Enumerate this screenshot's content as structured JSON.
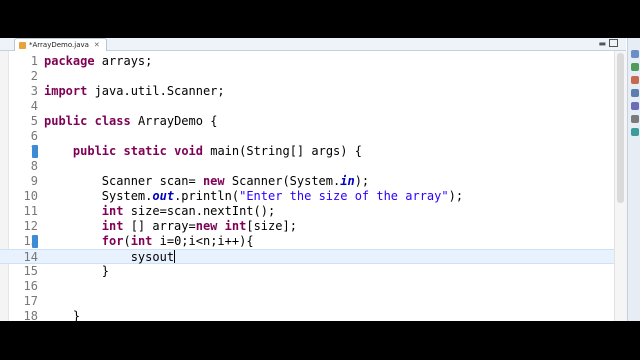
{
  "editor": {
    "tab": {
      "title": "*ArrayDemo.java",
      "close_glyph": "✕"
    },
    "window_controls": {
      "minimize": "▬",
      "maximize": ""
    },
    "lines": [
      {
        "number": "1",
        "tokens": [
          [
            "kw",
            "package"
          ],
          [
            "t",
            " arrays;"
          ]
        ]
      },
      {
        "number": "2",
        "tokens": []
      },
      {
        "number": "3",
        "tokens": [
          [
            "kw",
            "import"
          ],
          [
            "t",
            " java.util.Scanner;"
          ]
        ]
      },
      {
        "number": "4",
        "tokens": []
      },
      {
        "number": "5",
        "tokens": [
          [
            "kw",
            "public"
          ],
          [
            "t",
            " "
          ],
          [
            "kw",
            "class"
          ],
          [
            "t",
            " ArrayDemo {"
          ]
        ]
      },
      {
        "number": "6",
        "tokens": []
      },
      {
        "number": "7",
        "collapse": true,
        "tokens": [
          [
            "t",
            "    "
          ],
          [
            "kw",
            "public"
          ],
          [
            "t",
            " "
          ],
          [
            "kw",
            "static"
          ],
          [
            "t",
            " "
          ],
          [
            "kw",
            "void"
          ],
          [
            "t",
            " main(String[] args) {"
          ]
        ]
      },
      {
        "number": "8",
        "tokens": []
      },
      {
        "number": "9",
        "tokens": [
          [
            "t",
            "        Scanner scan= "
          ],
          [
            "kw",
            "new"
          ],
          [
            "t",
            " Scanner(System."
          ],
          [
            "fi",
            "in"
          ],
          [
            "t",
            ");"
          ]
        ]
      },
      {
        "number": "10",
        "tokens": [
          [
            "t",
            "        System."
          ],
          [
            "fi",
            "out"
          ],
          [
            "t",
            ".println("
          ],
          [
            "st",
            "\"Enter the size of the array\""
          ],
          [
            "t",
            ");"
          ]
        ]
      },
      {
        "number": "11",
        "tokens": [
          [
            "t",
            "        "
          ],
          [
            "kw",
            "int"
          ],
          [
            "t",
            " size=scan.nextInt();"
          ]
        ]
      },
      {
        "number": "12",
        "tokens": [
          [
            "t",
            "        "
          ],
          [
            "kw",
            "int"
          ],
          [
            "t",
            " [] array="
          ],
          [
            "kw",
            "new"
          ],
          [
            "t",
            " "
          ],
          [
            "kw",
            "int"
          ],
          [
            "t",
            "[size];"
          ]
        ]
      },
      {
        "number": "13",
        "collapse": true,
        "tokens": [
          [
            "t",
            "        "
          ],
          [
            "kw",
            "for"
          ],
          [
            "t",
            "("
          ],
          [
            "kw",
            "int"
          ],
          [
            "t",
            " i=0;i<n;i++){"
          ]
        ]
      },
      {
        "number": "14",
        "current": true,
        "caret": true,
        "tokens": [
          [
            "t",
            "            sysout"
          ]
        ]
      },
      {
        "number": "15",
        "tokens": [
          [
            "t",
            "        }"
          ]
        ]
      },
      {
        "number": "16",
        "tokens": []
      },
      {
        "number": "17",
        "tokens": []
      },
      {
        "number": "18",
        "tokens": [
          [
            "t",
            "    }"
          ]
        ]
      }
    ]
  },
  "trim_icons": [
    {
      "name": "outline-icon",
      "color": "#6a8fc4"
    },
    {
      "name": "task-list-icon",
      "color": "#4f9b5d"
    },
    {
      "name": "problems-icon",
      "color": "#c46a4f"
    },
    {
      "name": "javadoc-icon",
      "color": "#5b7db0"
    },
    {
      "name": "declaration-icon",
      "color": "#6b6bb8"
    },
    {
      "name": "console-icon",
      "color": "#7a7a7a"
    },
    {
      "name": "progress-icon",
      "color": "#3c9b9b"
    }
  ]
}
